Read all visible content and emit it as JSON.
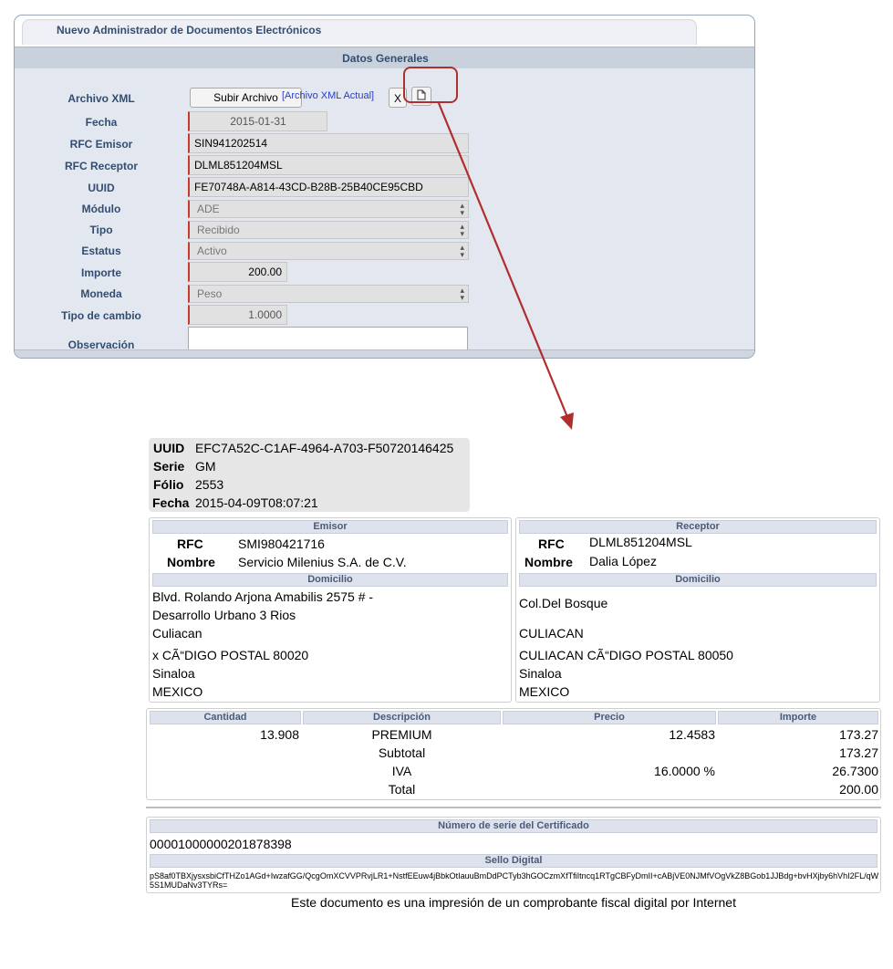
{
  "form": {
    "title": "Nuevo Administrador de Documentos Electrónicos",
    "section": "Datos Generales",
    "labels": {
      "archivo_xml": "Archivo XML",
      "fecha": "Fecha",
      "rfc_emisor": "RFC Emisor",
      "rfc_receptor": "RFC Receptor",
      "uuid": "UUID",
      "modulo": "Módulo",
      "tipo": "Tipo",
      "estatus": "Estatus",
      "importe": "Importe",
      "moneda": "Moneda",
      "tipo_cambio": "Tipo de cambio",
      "observacion": "Observación"
    },
    "upload_button": "Subir Archivo",
    "current_xml_link": "[Archivo XML Actual]",
    "clear_button": "X",
    "values": {
      "fecha": "2015-01-31",
      "rfc_emisor": "SIN941202514",
      "rfc_receptor": "DLML851204MSL",
      "uuid": "FE70748A-A814-43CD-B28B-25B40CE95CBD",
      "modulo": "ADE",
      "tipo": "Recibido",
      "estatus": "Activo",
      "importe": "200.00",
      "moneda": "Peso",
      "tipo_cambio": "1.0000",
      "observacion": ""
    }
  },
  "invoice": {
    "header": {
      "uuid_label": "UUID",
      "uuid": "EFC7A52C-C1AF-4964-A703-F50720146425",
      "serie_label": "Serie",
      "serie": "GM",
      "folio_label": "Fólio",
      "folio": "2553",
      "fecha_label": "Fecha",
      "fecha": "2015-04-09T08:07:21"
    },
    "emisor": {
      "title": "Emisor",
      "rfc_label": "RFC",
      "rfc": "SMI980421716",
      "nombre_label": "Nombre",
      "nombre": "Servicio Milenius S.A. de C.V.",
      "domicilio_title": "Domicilio",
      "address": [
        "Blvd. Rolando Arjona Amabilis 2575 # -",
        "Desarrollo Urbano 3 Rios",
        "Culiacan",
        "x CÃ“DIGO POSTAL 80020",
        "Sinaloa",
        "MEXICO"
      ]
    },
    "receptor": {
      "title": "Receptor",
      "rfc_label": "RFC",
      "rfc": "DLML851204MSL",
      "nombre_label": "Nombre",
      "nombre": "Dalia López",
      "domicilio_title": "Domicilio",
      "address": [
        "Col.Del Bosque",
        "CULIACAN",
        "CULIACAN CÃ“DIGO POSTAL 80050",
        "Sinaloa",
        "MEXICO"
      ]
    },
    "items": {
      "headers": [
        "Cantidad",
        "Descripción",
        "Precio",
        "Importe"
      ],
      "cantidad": "13.908",
      "descripcion": "PREMIUM",
      "precio": "12.4583",
      "importe": "173.27",
      "subtotal_label": "Subtotal",
      "subtotal": "173.27",
      "iva_label": "IVA",
      "iva_rate": "16.0000 %",
      "iva": "26.7300",
      "total_label": "Total",
      "total": "200.00"
    },
    "certificado": {
      "title": "Número de serie del Certificado",
      "numero": "00001000000201878398",
      "sello_title": "Sello Digital",
      "sello": "pS8af0TBXjysxsbiCfTHZo1AGd+IwzafGG/QcgOmXCVVPRvjLR1+NstfEEuw4jBbkOtIauuBmDdPCTyb3hGOCzmXfTfiItncq1RTgCBFyDmII+cABjVE0NJMfVOgVkZ8BGob1JJBdg+bvHXjby6hVhI2FL/qW5S1MUDaNv3TYRs="
    },
    "footer": "Este documento es una impresión de un comprobante fiscal digital por Internet"
  },
  "annotation_color": "#b12e2e"
}
